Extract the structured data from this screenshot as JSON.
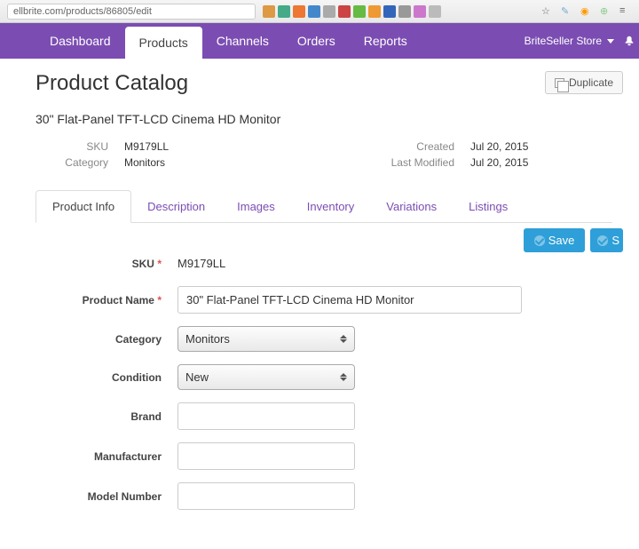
{
  "browser": {
    "url": "ellbrite.com/products/86805/edit"
  },
  "nav": {
    "items": [
      "Dashboard",
      "Products",
      "Channels",
      "Orders",
      "Reports"
    ],
    "active": 1,
    "store": "BriteSeller Store"
  },
  "page": {
    "title": "Product Catalog",
    "duplicate": "Duplicate",
    "product_heading": "30\" Flat-Panel TFT-LCD Cinema HD Monitor"
  },
  "meta": {
    "sku_label": "SKU",
    "sku": "M9179LL",
    "category_label": "Category",
    "category": "Monitors",
    "created_label": "Created",
    "created": "Jul 20, 2015",
    "modified_label": "Last Modified",
    "modified": "Jul 20, 2015"
  },
  "tabs": {
    "items": [
      "Product Info",
      "Description",
      "Images",
      "Inventory",
      "Variations",
      "Listings"
    ],
    "active": 0
  },
  "actions": {
    "save": "Save",
    "save_partial": "S"
  },
  "form": {
    "sku_label": "SKU",
    "sku_value": "M9179LL",
    "product_name_label": "Product Name",
    "product_name_value": "30\" Flat-Panel TFT-LCD Cinema HD Monitor",
    "category_label": "Category",
    "category_value": "Monitors",
    "condition_label": "Condition",
    "condition_value": "New",
    "brand_label": "Brand",
    "brand_value": "",
    "manufacturer_label": "Manufacturer",
    "manufacturer_value": "",
    "model_label": "Model Number",
    "model_value": ""
  }
}
